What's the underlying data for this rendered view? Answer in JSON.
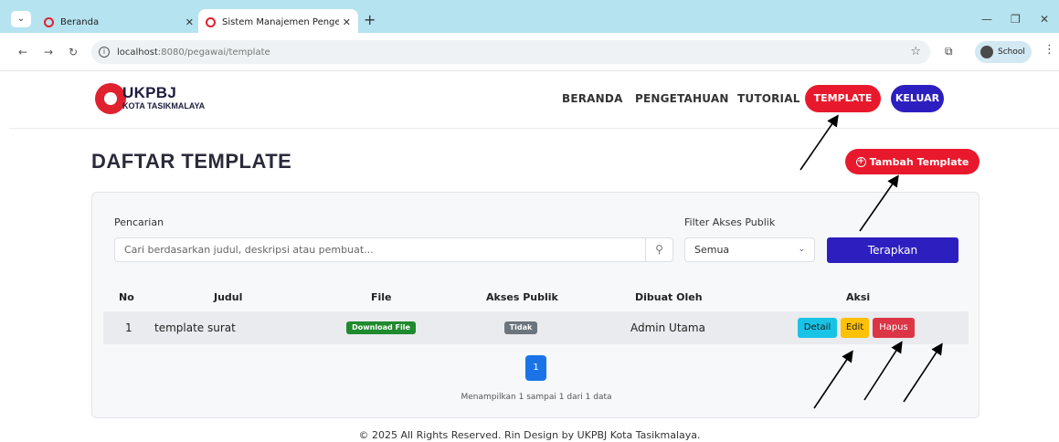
{
  "browser": {
    "tabs": [
      {
        "title": "Beranda"
      },
      {
        "title": "Sistem Manajemen Pengetahuan"
      }
    ],
    "url_host": "localhost",
    "url_path": ":8080/pegawai/template",
    "profile_label": "School"
  },
  "header": {
    "logo_title": "UKPBJ",
    "logo_subtitle": "KOTA TASIKMALAYA",
    "nav": {
      "beranda": "BERANDA",
      "pengetahuan": "PENGETAHUAN",
      "tutorial": "TUTORIAL",
      "template": "TEMPLATE",
      "keluar": "KELUAR"
    }
  },
  "main": {
    "title": "DAFTAR TEMPLATE",
    "add_button": "Tambah Template",
    "search_label": "Pencarian",
    "search_placeholder": "Cari berdasarkan judul, deskripsi atau pembuat...",
    "filter_label": "Filter Akses Publik",
    "filter_value": "Semua",
    "apply_button": "Terapkan",
    "table": {
      "headers": {
        "no": "No",
        "judul": "Judul",
        "file": "File",
        "akses": "Akses Publik",
        "dibuat": "Dibuat Oleh",
        "aksi": "Aksi"
      },
      "rows": [
        {
          "no": "1",
          "judul": "template surat",
          "file": "Download File",
          "akses": "Tidak",
          "dibuat": "Admin Utama",
          "detail": "Detail",
          "edit": "Edit",
          "hapus": "Hapus"
        }
      ]
    },
    "pagination": {
      "current": "1"
    },
    "showing": "Menampilkan 1 sampai 1 dari 1 data"
  },
  "footer": "© 2025 All Rights Reserved. Rin Design by UKPBJ Kota Tasikmalaya.",
  "colors": {
    "brand_red": "#e8192c",
    "brand_blue": "#2d1fbf",
    "download_green": "#1f8a2e",
    "detail_cyan": "#19c3e6",
    "edit_yellow": "#ffc107",
    "hapus_red": "#dc3545"
  }
}
